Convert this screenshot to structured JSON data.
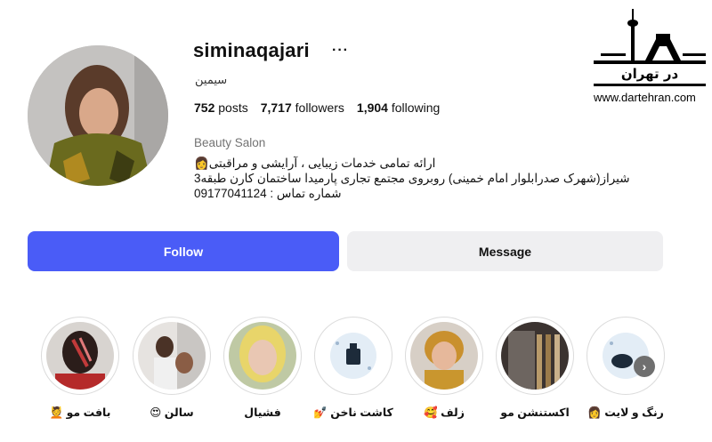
{
  "profile": {
    "username": "siminaqajari",
    "more": "···",
    "full_name": "سیمین",
    "stats": {
      "posts_count": "752",
      "posts_label": "posts",
      "followers_count": "7,717",
      "followers_label": "followers",
      "following_count": "1,904",
      "following_label": "following"
    },
    "category": "Beauty Salon",
    "bio": [
      "ارائه تمامی خدمات زیبایی ، آرایشی و مراقبتی👩",
      "شیراز(شهرک صدرابلوار امام خمینی) روبروی مجتمع تجاری پارمیدا ساختمان کارن طبقه3",
      "شماره تماس : 09177041124"
    ]
  },
  "actions": {
    "follow_label": "Follow",
    "message_label": "Message"
  },
  "highlights": [
    {
      "label": "بافت مو 💆"
    },
    {
      "label": "سالن 😍"
    },
    {
      "label": "فشیال"
    },
    {
      "label": "کاشت ناخن 💅"
    },
    {
      "label": "زلف 🥰"
    },
    {
      "label": "اکستنشن مو"
    },
    {
      "label": "رنگ و لایت 👩"
    }
  ],
  "watermark": {
    "logo_text": "در تهران",
    "url": "www.dartehran.com"
  },
  "colors": {
    "accent": "#4a5cf7",
    "button_gray": "#efeff1",
    "muted_text": "#737373"
  }
}
